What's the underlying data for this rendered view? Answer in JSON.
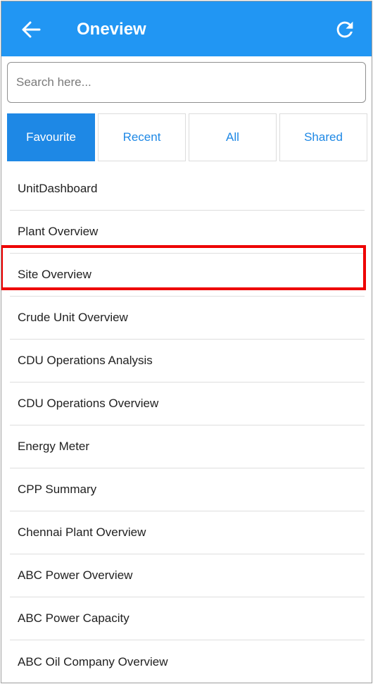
{
  "header": {
    "title": "Oneview",
    "back_icon": "arrow-left-icon",
    "refresh_icon": "refresh-icon",
    "bar_color": "#2196f3"
  },
  "search": {
    "placeholder": "Search here...",
    "value": ""
  },
  "tabs": [
    {
      "label": "Favourite",
      "active": true
    },
    {
      "label": "Recent",
      "active": false
    },
    {
      "label": "All",
      "active": false
    },
    {
      "label": "Shared",
      "active": false
    }
  ],
  "items": [
    {
      "label": "UnitDashboard"
    },
    {
      "label": "Plant Overview"
    },
    {
      "label": "Site Overview",
      "highlighted": true
    },
    {
      "label": "Crude Unit Overview"
    },
    {
      "label": "CDU Operations Analysis"
    },
    {
      "label": "CDU Operations Overview"
    },
    {
      "label": "Energy Meter"
    },
    {
      "label": "CPP Summary"
    },
    {
      "label": "Chennai Plant Overview"
    },
    {
      "label": "ABC Power Overview"
    },
    {
      "label": "ABC Power Capacity"
    },
    {
      "label": "ABC Oil Company Overview"
    }
  ],
  "highlight_color": "#ee0000",
  "accent_color": "#1e88e5"
}
